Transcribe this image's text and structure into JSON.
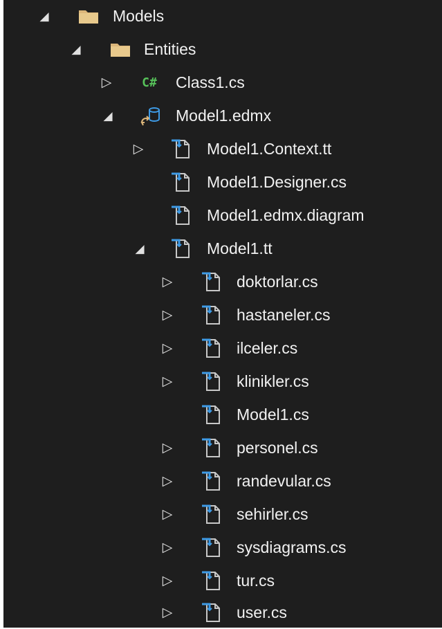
{
  "tree": {
    "nodes": [
      {
        "label": "Models",
        "icon": "folder-icon",
        "arrow": "expanded"
      },
      {
        "label": "Entities",
        "icon": "folder-icon",
        "arrow": "expanded"
      },
      {
        "label": "Class1.cs",
        "icon": "csharp-file-icon",
        "arrow": "collapsed",
        "icon_text": "C#"
      },
      {
        "label": "Model1.edmx",
        "icon": "edmx-database-icon",
        "arrow": "expanded"
      },
      {
        "label": "Model1.Context.tt",
        "icon": "generated-file-icon",
        "arrow": "collapsed"
      },
      {
        "label": "Model1.Designer.cs",
        "icon": "generated-file-icon",
        "arrow": "none"
      },
      {
        "label": "Model1.edmx.diagram",
        "icon": "generated-file-icon",
        "arrow": "none"
      },
      {
        "label": "Model1.tt",
        "icon": "generated-file-icon",
        "arrow": "expanded"
      },
      {
        "label": "doktorlar.cs",
        "icon": "generated-file-icon",
        "arrow": "collapsed"
      },
      {
        "label": "hastaneler.cs",
        "icon": "generated-file-icon",
        "arrow": "collapsed"
      },
      {
        "label": "ilceler.cs",
        "icon": "generated-file-icon",
        "arrow": "collapsed"
      },
      {
        "label": "klinikler.cs",
        "icon": "generated-file-icon",
        "arrow": "collapsed"
      },
      {
        "label": "Model1.cs",
        "icon": "generated-file-icon",
        "arrow": "none"
      },
      {
        "label": "personel.cs",
        "icon": "generated-file-icon",
        "arrow": "collapsed"
      },
      {
        "label": "randevular.cs",
        "icon": "generated-file-icon",
        "arrow": "collapsed"
      },
      {
        "label": "sehirler.cs",
        "icon": "generated-file-icon",
        "arrow": "collapsed"
      },
      {
        "label": "sysdiagrams.cs",
        "icon": "generated-file-icon",
        "arrow": "collapsed"
      },
      {
        "label": "tur.cs",
        "icon": "generated-file-icon",
        "arrow": "collapsed"
      },
      {
        "label": "user.cs",
        "icon": "generated-file-icon",
        "arrow": "collapsed"
      }
    ]
  },
  "colors": {
    "background": "#1e1e1e",
    "text": "#f1f1f1",
    "folder": "#dcb67a",
    "csharp": "#57c25a",
    "accent_blue": "#3e9be6",
    "file_outline": "#c8c8c8"
  }
}
